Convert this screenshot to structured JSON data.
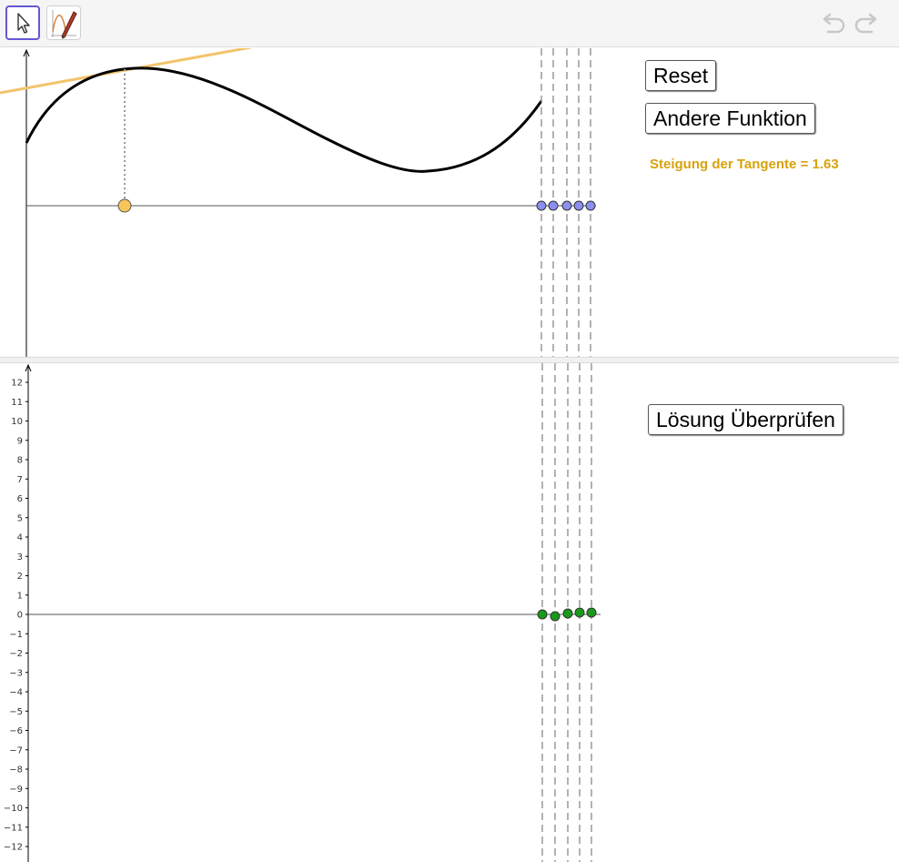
{
  "toolbar": {
    "tools": [
      {
        "name": "move-tool",
        "icon": "arrow-cursor-icon",
        "selected": true
      },
      {
        "name": "pen-tool",
        "icon": "function-pen-icon",
        "selected": false
      }
    ],
    "undo_icon": "undo-icon",
    "redo_icon": "redo-icon"
  },
  "top_view": {
    "buttons": {
      "reset": "Reset",
      "other_function": "Andere Funktion"
    },
    "slope_text": "Steigung der Tangente = 1.63",
    "slope_color": "#d8a20b",
    "curve_color": "#000000",
    "tangent_color": "#f2c46b",
    "tangent_point_color": "#f6c65b",
    "x_points_color": "#8b8ff0"
  },
  "bottom_view": {
    "buttons": {
      "check_solution": "Lösung Überprüfen"
    },
    "y_ticks": [
      "12",
      "11",
      "10",
      "9",
      "8",
      "7",
      "6",
      "5",
      "4",
      "3",
      "2",
      "1",
      "0",
      "−1",
      "−2",
      "−3",
      "−4",
      "−5",
      "−6",
      "−7",
      "−8",
      "−9",
      "−10",
      "−11",
      "−12"
    ],
    "derivative_point_color": "#1a9a1a"
  }
}
